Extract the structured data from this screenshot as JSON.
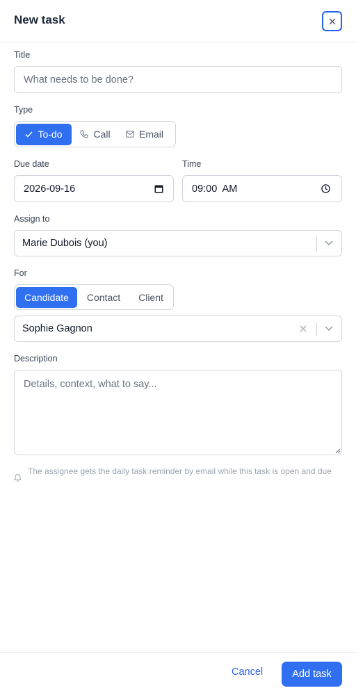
{
  "header": {
    "title": "New task"
  },
  "title_field": {
    "label": "Title",
    "placeholder": "What needs to be done?"
  },
  "type": {
    "label": "Type",
    "options": [
      {
        "label": "To-do",
        "icon": "check-icon",
        "active": true
      },
      {
        "label": "Call",
        "icon": "phone-icon",
        "active": false
      },
      {
        "label": "Email",
        "icon": "mail-icon",
        "active": false
      }
    ]
  },
  "due_date": {
    "label": "Due date",
    "value": "2026-09-16"
  },
  "time": {
    "label": "Time",
    "value": "09:00  AM"
  },
  "assign": {
    "label": "Assign to",
    "value": "Marie Dubois (you)"
  },
  "for_field": {
    "label": "For",
    "options": [
      {
        "label": "Candidate",
        "active": true
      },
      {
        "label": "Contact",
        "active": false
      },
      {
        "label": "Client",
        "active": false
      }
    ],
    "selected": "Sophie Gagnon"
  },
  "description": {
    "label": "Description",
    "placeholder": "Details, context, what to say..."
  },
  "hint": "The assignee gets the daily task reminder by email while this task is open and due",
  "footer": {
    "cancel": "Cancel",
    "submit": "Add task"
  },
  "colors": {
    "accent": "#2f6ff0",
    "border": "#d1d5db"
  }
}
